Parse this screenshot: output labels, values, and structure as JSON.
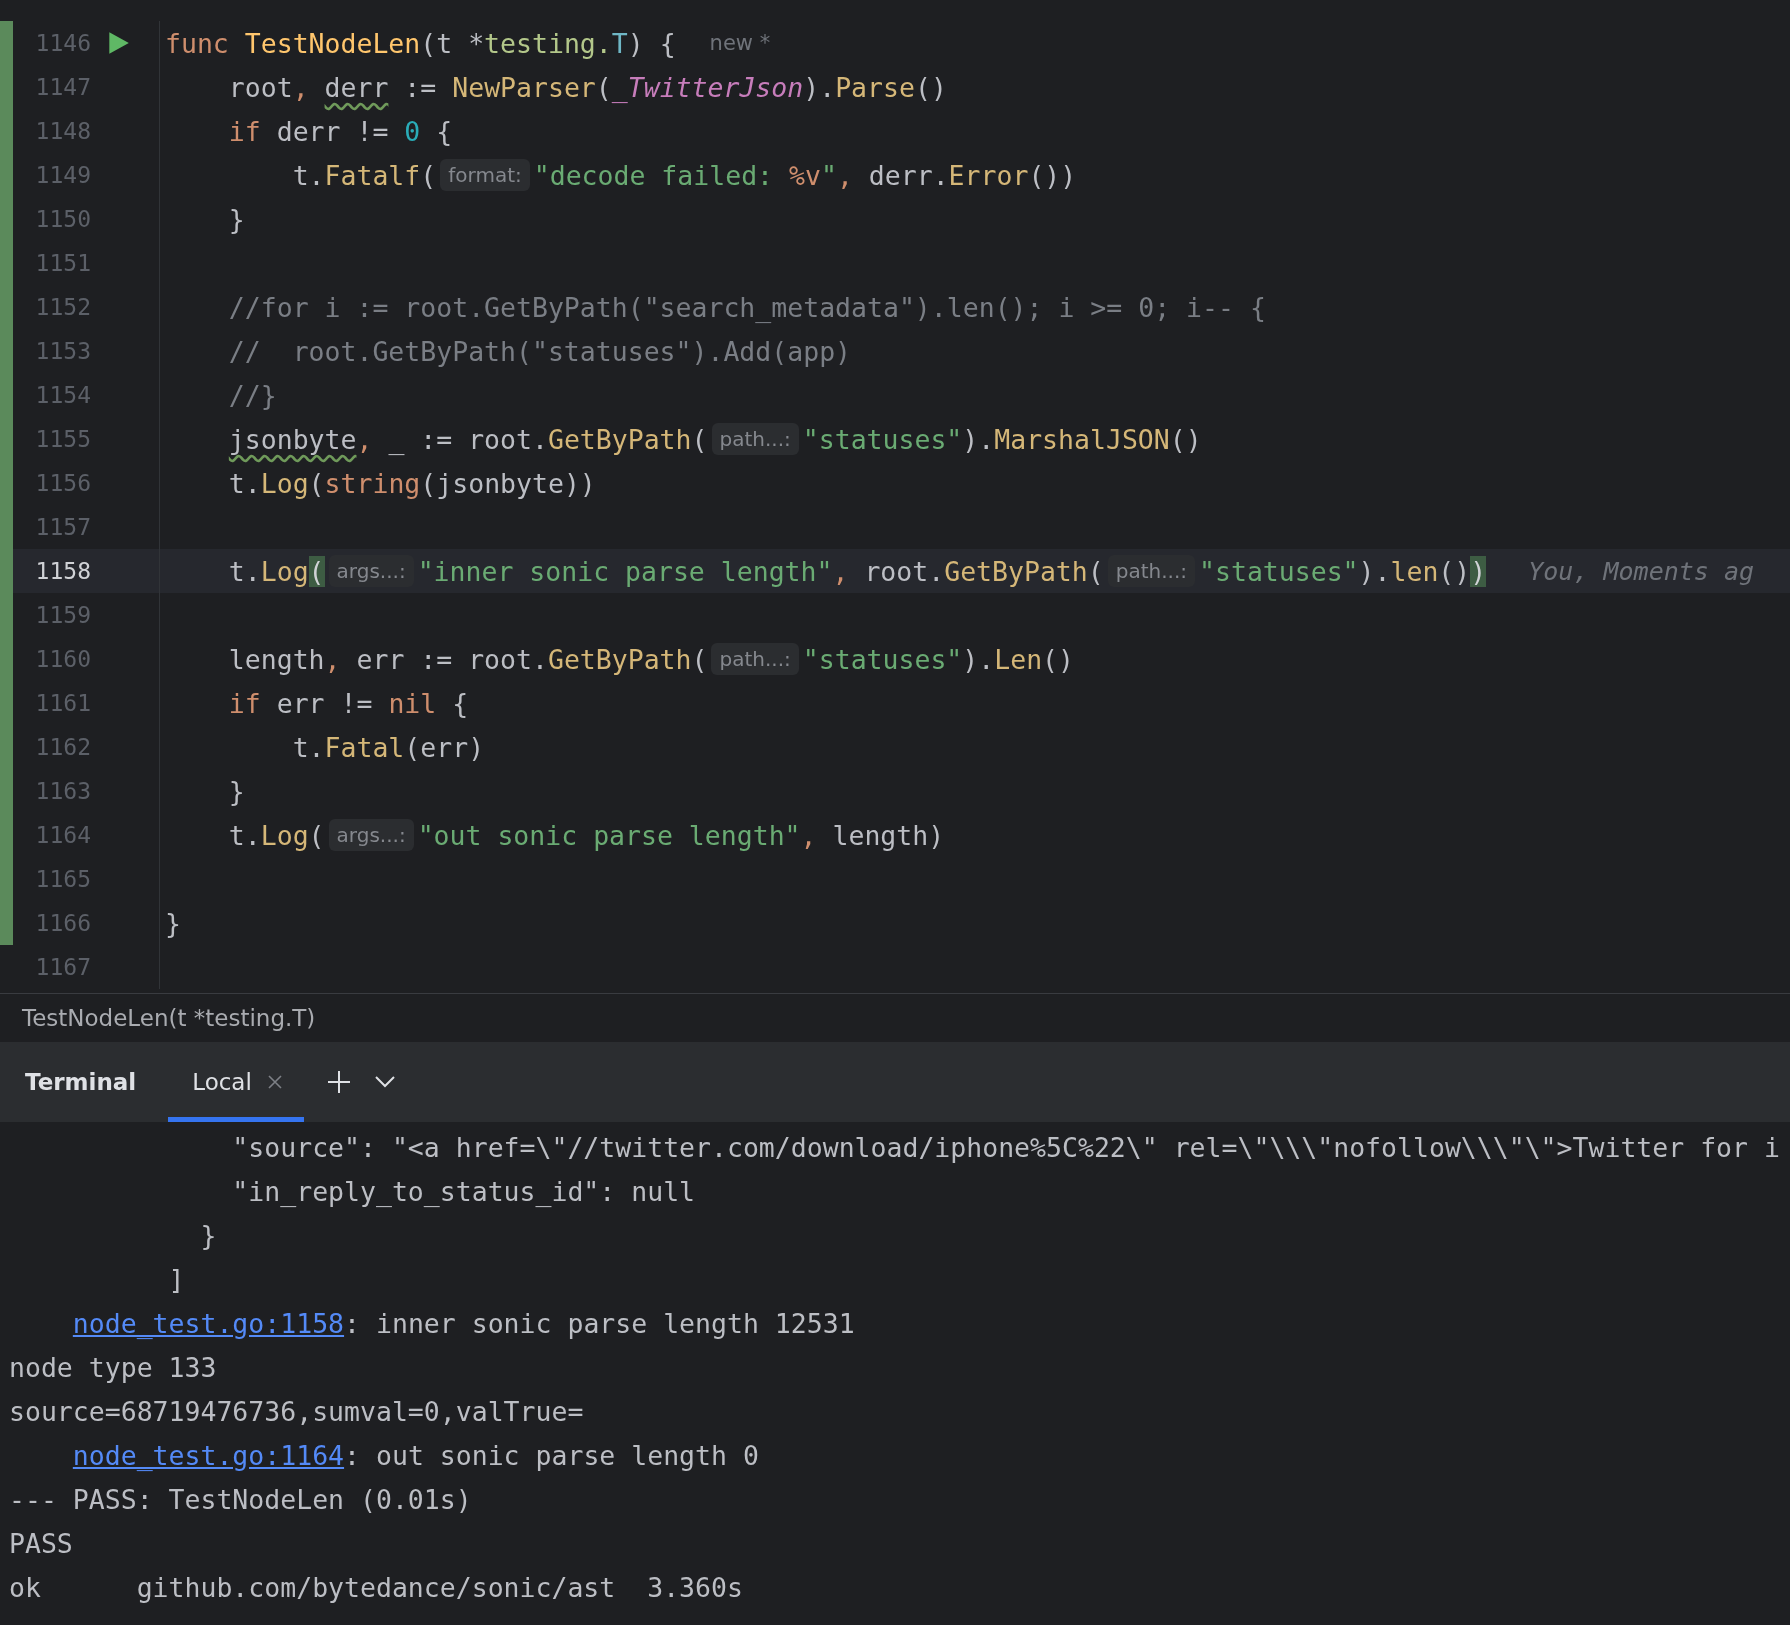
{
  "editor": {
    "lines": [
      {
        "number": "1146",
        "changed": true,
        "run": true,
        "current": false,
        "tokens": [
          {
            "kind": "keyword",
            "text": "func "
          },
          {
            "kind": "declaration",
            "text": "TestNodeLen"
          },
          {
            "kind": "plain",
            "text": "(t *"
          },
          {
            "kind": "package",
            "text": "testing."
          },
          {
            "kind": "type",
            "text": "T"
          },
          {
            "kind": "plain",
            "text": ") {"
          },
          {
            "kind": "author",
            "text": "new *"
          }
        ]
      },
      {
        "number": "1147",
        "changed": true,
        "run": false,
        "current": false,
        "tokens": [
          {
            "kind": "plain",
            "text": "    root"
          },
          {
            "kind": "keyword",
            "text": ", "
          },
          {
            "kind": "warning",
            "text": "derr"
          },
          {
            "kind": "plain",
            "text": " := "
          },
          {
            "kind": "call",
            "text": "NewParser"
          },
          {
            "kind": "plain",
            "text": "("
          },
          {
            "kind": "constant",
            "text": "_TwitterJson"
          },
          {
            "kind": "plain",
            "text": ")."
          },
          {
            "kind": "call",
            "text": "Parse"
          },
          {
            "kind": "plain",
            "text": "()"
          }
        ]
      },
      {
        "number": "1148",
        "changed": true,
        "run": false,
        "current": false,
        "tokens": [
          {
            "kind": "keyword",
            "text": "    if"
          },
          {
            "kind": "plain",
            "text": " derr != "
          },
          {
            "kind": "number",
            "text": "0"
          },
          {
            "kind": "plain",
            "text": " {"
          }
        ]
      },
      {
        "number": "1149",
        "changed": true,
        "run": false,
        "current": false,
        "tokens": [
          {
            "kind": "plain",
            "text": "        t."
          },
          {
            "kind": "call",
            "text": "Fatalf"
          },
          {
            "kind": "plain",
            "text": "("
          },
          {
            "kind": "hint",
            "text": "format:"
          },
          {
            "kind": "string",
            "text": "\"decode failed: "
          },
          {
            "kind": "format",
            "text": "%v"
          },
          {
            "kind": "string",
            "text": "\""
          },
          {
            "kind": "keyword",
            "text": ", "
          },
          {
            "kind": "plain",
            "text": "derr."
          },
          {
            "kind": "call",
            "text": "Error"
          },
          {
            "kind": "plain",
            "text": "())"
          }
        ]
      },
      {
        "number": "1150",
        "changed": true,
        "run": false,
        "current": false,
        "tokens": [
          {
            "kind": "plain",
            "text": "    }"
          }
        ]
      },
      {
        "number": "1151",
        "changed": true,
        "run": false,
        "current": false
      },
      {
        "number": "1152",
        "changed": true,
        "run": false,
        "current": false,
        "tokens": [
          {
            "kind": "comment",
            "text": "    //for i := root.GetByPath(\"search_metadata\").len(); i >= 0; i-- {"
          }
        ]
      },
      {
        "number": "1153",
        "changed": true,
        "run": false,
        "current": false,
        "tokens": [
          {
            "kind": "comment",
            "text": "    //  root.GetByPath(\"statuses\").Add(app)"
          }
        ]
      },
      {
        "number": "1154",
        "changed": true,
        "run": false,
        "current": false,
        "tokens": [
          {
            "kind": "comment",
            "text": "    //}"
          }
        ]
      },
      {
        "number": "1155",
        "changed": true,
        "run": false,
        "current": false,
        "tokens": [
          {
            "kind": "warning",
            "text": "    jsonbyte"
          },
          {
            "kind": "keyword",
            "text": ", "
          },
          {
            "kind": "plain",
            "text": "_ := root."
          },
          {
            "kind": "call",
            "text": "GetByPath"
          },
          {
            "kind": "plain",
            "text": "("
          },
          {
            "kind": "hint",
            "text": "path...:"
          },
          {
            "kind": "string",
            "text": "\"statuses\""
          },
          {
            "kind": "plain",
            "text": ")."
          },
          {
            "kind": "call",
            "text": "MarshalJSON"
          },
          {
            "kind": "plain",
            "text": "()"
          }
        ]
      },
      {
        "number": "1156",
        "changed": true,
        "run": false,
        "current": false,
        "tokens": [
          {
            "kind": "plain",
            "text": "    t."
          },
          {
            "kind": "call",
            "text": "Log"
          },
          {
            "kind": "plain",
            "text": "("
          },
          {
            "kind": "keyword",
            "text": "string"
          },
          {
            "kind": "plain",
            "text": "(jsonbyte))"
          }
        ]
      },
      {
        "number": "1157",
        "changed": true,
        "run": false,
        "current": false
      },
      {
        "number": "1158",
        "changed": true,
        "run": false,
        "current": true,
        "tokens": [
          {
            "kind": "plain",
            "text": "    t."
          },
          {
            "kind": "call",
            "text": "Log"
          },
          {
            "kind": "match",
            "text": "("
          },
          {
            "kind": "hint",
            "text": "args...:"
          },
          {
            "kind": "string",
            "text": "\"inner sonic parse length\""
          },
          {
            "kind": "keyword",
            "text": ", "
          },
          {
            "kind": "plain",
            "text": "root."
          },
          {
            "kind": "call",
            "text": "GetByPath"
          },
          {
            "kind": "plain",
            "text": "("
          },
          {
            "kind": "hint",
            "text": "path...:"
          },
          {
            "kind": "string",
            "text": "\"statuses\""
          },
          {
            "kind": "plain",
            "text": ")."
          },
          {
            "kind": "call",
            "text": "len"
          },
          {
            "kind": "plain",
            "text": "()"
          },
          {
            "kind": "match",
            "text": ")"
          },
          {
            "kind": "blame",
            "text": "You, Moments ag"
          }
        ]
      },
      {
        "number": "1159",
        "changed": true,
        "run": false,
        "current": false
      },
      {
        "number": "1160",
        "changed": true,
        "run": false,
        "current": false,
        "tokens": [
          {
            "kind": "plain",
            "text": "    length"
          },
          {
            "kind": "keyword",
            "text": ", "
          },
          {
            "kind": "plain",
            "text": "err := root."
          },
          {
            "kind": "call",
            "text": "GetByPath"
          },
          {
            "kind": "plain",
            "text": "("
          },
          {
            "kind": "hint",
            "text": "path...:"
          },
          {
            "kind": "string",
            "text": "\"statuses\""
          },
          {
            "kind": "plain",
            "text": ")."
          },
          {
            "kind": "call",
            "text": "Len"
          },
          {
            "kind": "plain",
            "text": "()"
          }
        ]
      },
      {
        "number": "1161",
        "changed": true,
        "run": false,
        "current": false,
        "tokens": [
          {
            "kind": "keyword",
            "text": "    if"
          },
          {
            "kind": "plain",
            "text": " err != "
          },
          {
            "kind": "keyword",
            "text": "nil"
          },
          {
            "kind": "plain",
            "text": " {"
          }
        ]
      },
      {
        "number": "1162",
        "changed": true,
        "run": false,
        "current": false,
        "tokens": [
          {
            "kind": "plain",
            "text": "        t."
          },
          {
            "kind": "call",
            "text": "Fatal"
          },
          {
            "kind": "plain",
            "text": "(err)"
          }
        ]
      },
      {
        "number": "1163",
        "changed": true,
        "run": false,
        "current": false,
        "tokens": [
          {
            "kind": "plain",
            "text": "    }"
          }
        ]
      },
      {
        "number": "1164",
        "changed": true,
        "run": false,
        "current": false,
        "tokens": [
          {
            "kind": "plain",
            "text": "    t."
          },
          {
            "kind": "call",
            "text": "Log"
          },
          {
            "kind": "plain",
            "text": "("
          },
          {
            "kind": "hint",
            "text": "args...:"
          },
          {
            "kind": "string",
            "text": "\"out sonic parse length\""
          },
          {
            "kind": "keyword",
            "text": ", "
          },
          {
            "kind": "plain",
            "text": "length)"
          }
        ]
      },
      {
        "number": "1165",
        "changed": true,
        "run": false,
        "current": false
      },
      {
        "number": "1166",
        "changed": true,
        "run": false,
        "current": false,
        "tokens": [
          {
            "kind": "plain",
            "text": "}"
          }
        ]
      },
      {
        "number": "1167",
        "changed": false,
        "run": false,
        "current": false
      }
    ]
  },
  "breadcrumb": "TestNodeLen(t *testing.T)",
  "tool_window": {
    "title": "Terminal",
    "tabs": [
      {
        "label": "Local",
        "selected": true
      }
    ]
  },
  "terminal": {
    "lines": [
      [
        {
          "kind": "plain",
          "text": "              \"source\": \"<a href=\\\"//twitter.com/download/iphone%5C%22\\\" rel=\\\"\\\\\\\"nofollow\\\\\\\"\\\">Twitter for i"
        }
      ],
      [
        {
          "kind": "plain",
          "text": "              \"in_reply_to_status_id\": null"
        }
      ],
      [
        {
          "kind": "plain",
          "text": "            }"
        }
      ],
      [
        {
          "kind": "plain",
          "text": "          ]"
        }
      ],
      [
        {
          "kind": "link",
          "text": "    node_test.go:1158"
        },
        {
          "kind": "plain",
          "text": ": inner sonic parse length 12531"
        }
      ],
      [
        {
          "kind": "plain",
          "text": "node type 133"
        }
      ],
      [
        {
          "kind": "plain",
          "text": "source=68719476736,sumval=0,valTrue="
        }
      ],
      [
        {
          "kind": "link",
          "text": "    node_test.go:1164"
        },
        {
          "kind": "plain",
          "text": ": out sonic parse length 0"
        }
      ],
      [
        {
          "kind": "plain",
          "text": "--- PASS: TestNodeLen (0.01s)"
        }
      ],
      [
        {
          "kind": "plain",
          "text": "PASS"
        }
      ],
      [
        {
          "kind": "plain",
          "text": "ok      github.com/bytedance/sonic/ast  3.360s"
        }
      ]
    ]
  }
}
